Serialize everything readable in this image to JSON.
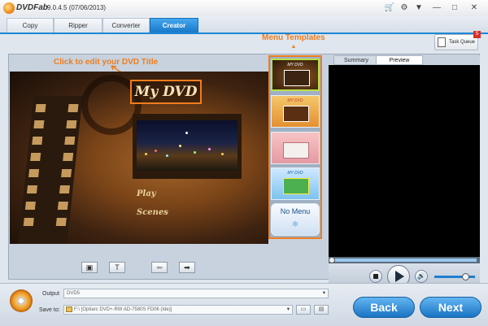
{
  "app": {
    "title": "DVDFab",
    "version": "9.0.4.5 (07/06/2013)"
  },
  "titlebar_icons": [
    "cart-icon",
    "gear-icon",
    "minimize-icon",
    "maximize-icon",
    "close-icon"
  ],
  "tabs": [
    {
      "label": "Copy",
      "active": false
    },
    {
      "label": "Ripper",
      "active": false
    },
    {
      "label": "Converter",
      "active": false
    },
    {
      "label": "Creator",
      "active": true
    }
  ],
  "annotations": {
    "menu_templates": "Menu Templates",
    "click_edit": "Click to edit your DVD Title"
  },
  "task_queue": {
    "label": "Task Queue",
    "badge": "5"
  },
  "menu_preview": {
    "title": "My DVD",
    "play": "Play",
    "scenes": "Scenes"
  },
  "templates": [
    {
      "name": "template-1",
      "mini_title": "MY DVD",
      "selected": true
    },
    {
      "name": "template-2",
      "mini_title": "MY DVD",
      "selected": false
    },
    {
      "name": "template-3",
      "mini_title": "",
      "selected": false
    },
    {
      "name": "template-4",
      "mini_title": "MY DVD",
      "selected": false
    },
    {
      "name": "no-menu",
      "label": "No Menu",
      "selected": false
    }
  ],
  "preview_tabs": [
    {
      "label": "Summary",
      "active": false
    },
    {
      "label": "Preview",
      "active": true
    }
  ],
  "player": {
    "volume_level": 0.75,
    "seek_position": 0
  },
  "bottom": {
    "output_label": "Output",
    "output_value": "DVD5",
    "save_label": "Save to:",
    "save_value": "F:\\ [Optiarc DVD+-RW AD-7580S FD06 (Ide)]",
    "back_label": "Back",
    "next_label": "Next"
  },
  "colors": {
    "accent_orange": "#f07d1e",
    "button_blue": "#1a74c4",
    "selected_template_border": "#b8e04a"
  }
}
